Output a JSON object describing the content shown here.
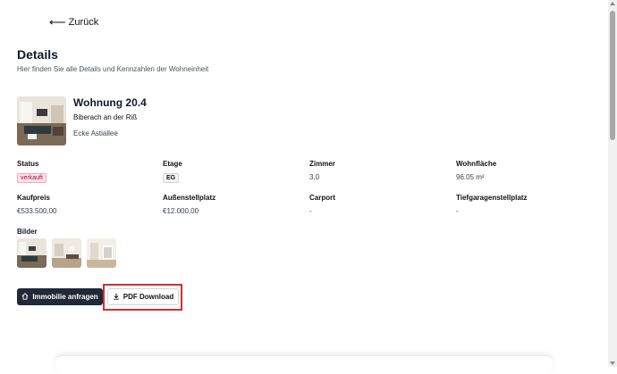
{
  "nav": {
    "back_label": "Zurück"
  },
  "page": {
    "title": "Details",
    "subtitle": "Hier finden Sie alle Details und Kennzahlen der Wohneinheit"
  },
  "unit": {
    "name": "Wohnung 20.4",
    "city": "Biberach an der Riß",
    "street": "Ecke Astiallee"
  },
  "fields": {
    "status": {
      "label": "Status",
      "value": "verkauft"
    },
    "etage": {
      "label": "Etage",
      "value": "EG"
    },
    "zimmer": {
      "label": "Zimmer",
      "value": "3,0"
    },
    "wohnflaeche": {
      "label": "Wohnfläche",
      "value": "96.05 m²"
    },
    "kaufpreis": {
      "label": "Kaufpreis",
      "value": "€533.500,00"
    },
    "aussenstellplatz": {
      "label": "Außenstellplatz",
      "value": "€12.000,00"
    },
    "carport": {
      "label": "Carport",
      "value": "-"
    },
    "tiefgarage": {
      "label": "Tiefgaragenstellplatz",
      "value": "-"
    }
  },
  "gallery": {
    "label": "Bilder"
  },
  "actions": {
    "inquire_label": "Immobilie anfragen",
    "pdf_label": "PDF Download"
  },
  "icons": {
    "back": "arrow-left-icon",
    "home": "home-icon",
    "download": "download-icon"
  },
  "colors": {
    "primary_button": "#1f2937",
    "sold_badge_bg": "#fde2e7",
    "sold_badge_text": "#9f1239",
    "highlight": "#d32f2f"
  }
}
